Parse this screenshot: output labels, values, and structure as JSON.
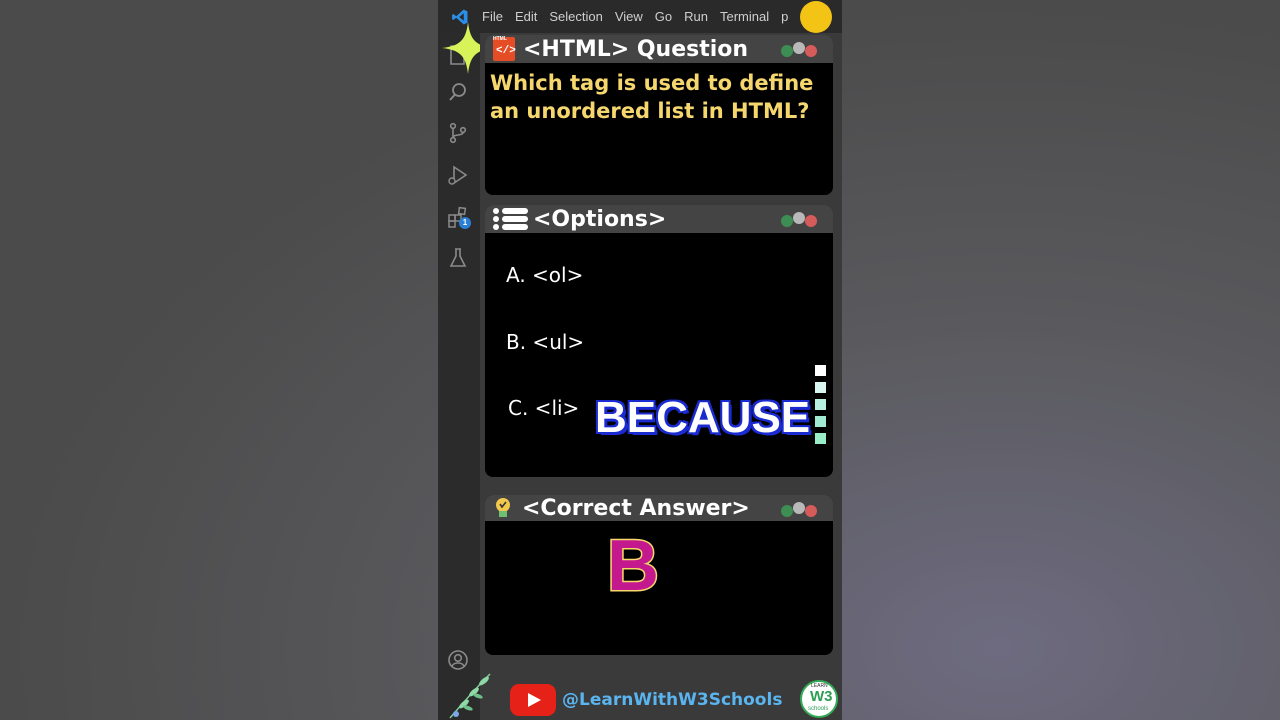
{
  "menu": {
    "items": [
      "File",
      "Edit",
      "Selection",
      "View",
      "Go",
      "Run",
      "Terminal"
    ],
    "partial_item": "p"
  },
  "sidebar": {
    "icons": [
      "explorer-icon",
      "search-icon",
      "source-control-icon",
      "run-debug-icon",
      "extensions-icon",
      "testing-icon",
      "account-icon"
    ],
    "extensions_badge": "1"
  },
  "question_card": {
    "title": "<HTML> Question",
    "badge": "HTML",
    "text": "Which tag is used to define an unordered list in HTML?"
  },
  "options_card": {
    "title": "<Options>",
    "options": [
      "A. <ol>",
      "B. <ul>",
      "C. <li>"
    ],
    "caption": "BECAUSE"
  },
  "answer_card": {
    "title": "<Correct Answer>",
    "answer": "B"
  },
  "footer": {
    "handle": "@LearnWithW3Schools",
    "logo_text": "W3",
    "logo_sub": "schools",
    "logo_top": "LEARN"
  },
  "colors": {
    "question_text": "#f5d76e",
    "handle": "#5ab4f0",
    "answer_fill": "#c4188f",
    "because_stroke": "#1a2bd1",
    "accent_star": "#d8f25a"
  }
}
